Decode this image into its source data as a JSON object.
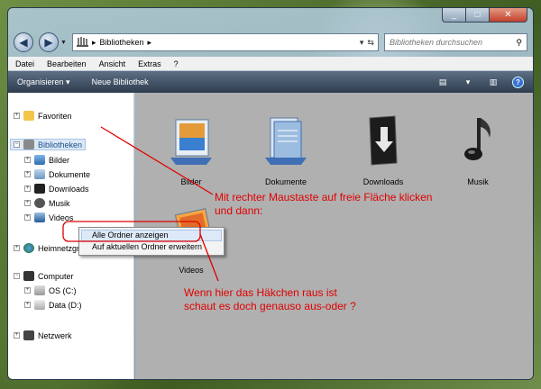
{
  "address": {
    "crumb": "Bibliotheken"
  },
  "search": {
    "placeholder": "Bibliotheken durchsuchen"
  },
  "menubar": {
    "items": [
      "Datei",
      "Bearbeiten",
      "Ansicht",
      "Extras",
      "?"
    ]
  },
  "toolbar": {
    "organize": "Organisieren",
    "new_library": "Neue Bibliothek"
  },
  "nav": {
    "favorites": "Favoriten",
    "libraries": "Bibliotheken",
    "lib_items": [
      "Bilder",
      "Dokumente",
      "Downloads",
      "Musik",
      "Videos"
    ],
    "homegroup": "Heimnetzgruppe",
    "computer": "Computer",
    "drives": [
      "OS (C:)",
      "Data (D:)"
    ],
    "network": "Netzwerk"
  },
  "tiles": [
    "Bilder",
    "Dokumente",
    "Downloads",
    "Musik",
    "Videos"
  ],
  "context_menu": {
    "items": [
      "Alle Ordner anzeigen",
      "Auf aktuellen Ordner erweitern"
    ]
  },
  "annotations": {
    "a1_line1": "Mit rechter Maustaste auf freie Fläche klicken",
    "a1_line2": "und dann:",
    "a2_line1": "Wenn hier das Häkchen raus ist",
    "a2_line2": "schaut es doch genauso aus-oder ?"
  },
  "colors": {
    "annotation": "#e00000",
    "toolbar": "#2e3c4e",
    "selection": "#dbe8f6"
  }
}
